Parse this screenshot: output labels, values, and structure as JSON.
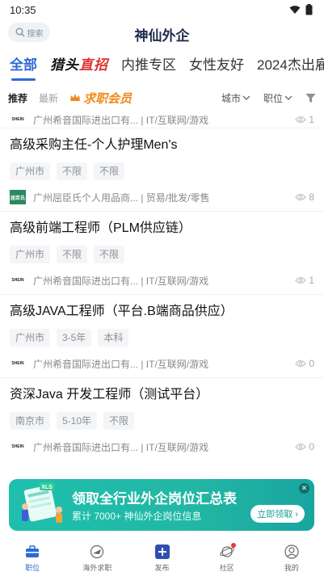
{
  "status": {
    "time": "10:35"
  },
  "header": {
    "search_placeholder": "搜索",
    "title": "神仙外企"
  },
  "tabs": [
    {
      "label": "全部",
      "active": true
    },
    {
      "label_main": "猎头",
      "label_accent": "直招",
      "brand": true
    },
    {
      "label": "内推专区"
    },
    {
      "label": "女性友好"
    },
    {
      "label": "2024杰出雇"
    }
  ],
  "filters": {
    "recommend": "推荐",
    "latest": "最新",
    "vip": "求职会员",
    "city": "城市",
    "position": "职位"
  },
  "top_company": {
    "logo": "SHEIN",
    "text": "广州希音国际进出口有... | IT/互联网/游戏",
    "views": "1"
  },
  "jobs": [
    {
      "title": "高级采购主任-个人护理Men's",
      "tags": [
        "广州市",
        "不限",
        "不限"
      ],
      "company_logo": "屈臣氏",
      "company": "广州屈臣氏个人用品商... | 贸易/批发/零售",
      "views": "8"
    },
    {
      "title": "高级前端工程师（PLM供应链）",
      "tags": [
        "广州市",
        "不限",
        "不限"
      ],
      "company_logo": "SHEIN",
      "company": "广州希音国际进出口有... | IT/互联网/游戏",
      "views": "1"
    },
    {
      "title": "高级JAVA工程师（平台.B端商品供应）",
      "tags": [
        "广州市",
        "3-5年",
        "本科"
      ],
      "company_logo": "SHEIN",
      "company": "广州希音国际进出口有... | IT/互联网/游戏",
      "views": "0"
    },
    {
      "title": "资深Java 开发工程师（测试平台）",
      "tags": [
        "南京市",
        "5-10年",
        "不限"
      ],
      "company_logo": "SHEIN",
      "company": "广州希音国际进出口有... | IT/互联网/游戏",
      "views": "0"
    }
  ],
  "banner": {
    "title": "领取全行业外企岗位汇总表",
    "subtitle": "累计 7000+ 神仙外企岗位信息",
    "button": "立即领取 ›",
    "art_label": "XLS"
  },
  "nav": [
    {
      "label": "职位",
      "icon": "briefcase-icon",
      "active": true
    },
    {
      "label": "海外求职",
      "icon": "plane-icon"
    },
    {
      "label": "发布",
      "icon": "plus-icon"
    },
    {
      "label": "社区",
      "icon": "planet-icon",
      "badge": true
    },
    {
      "label": "我的",
      "icon": "user-icon"
    }
  ],
  "colors": {
    "accent": "#2f6bd6",
    "vip": "#f08a1a",
    "banner": "#1fbfae"
  }
}
